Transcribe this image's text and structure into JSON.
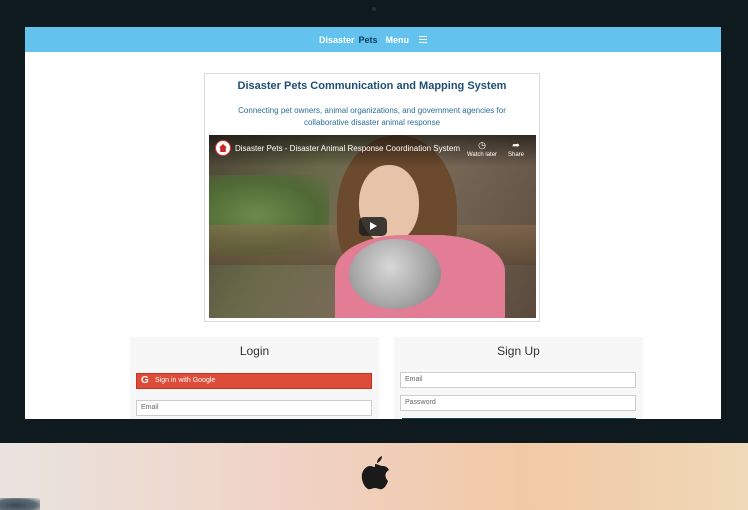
{
  "nav": {
    "brand_part1": "Disaster",
    "brand_part2": "Pets",
    "menu_label": "Menu"
  },
  "intro": {
    "title": "Disaster Pets Communication and Mapping System",
    "subtitle": "Connecting pet owners, animal organizations, and government agencies for collaborative disaster animal response"
  },
  "video": {
    "title": "Disaster Pets - Disaster Animal Response Coordination System",
    "watch_later": "Watch later",
    "share": "Share"
  },
  "login": {
    "title": "Login",
    "google_button": "Sign in with Google",
    "email_placeholder": "Email"
  },
  "signup": {
    "title": "Sign Up",
    "email_placeholder": "Email",
    "password_placeholder": "Password"
  },
  "colors": {
    "nav_bg": "#63c2ee",
    "brand_dark": "#0d3b5e",
    "google_red": "#dd4b39",
    "title_blue": "#1d4f73"
  }
}
